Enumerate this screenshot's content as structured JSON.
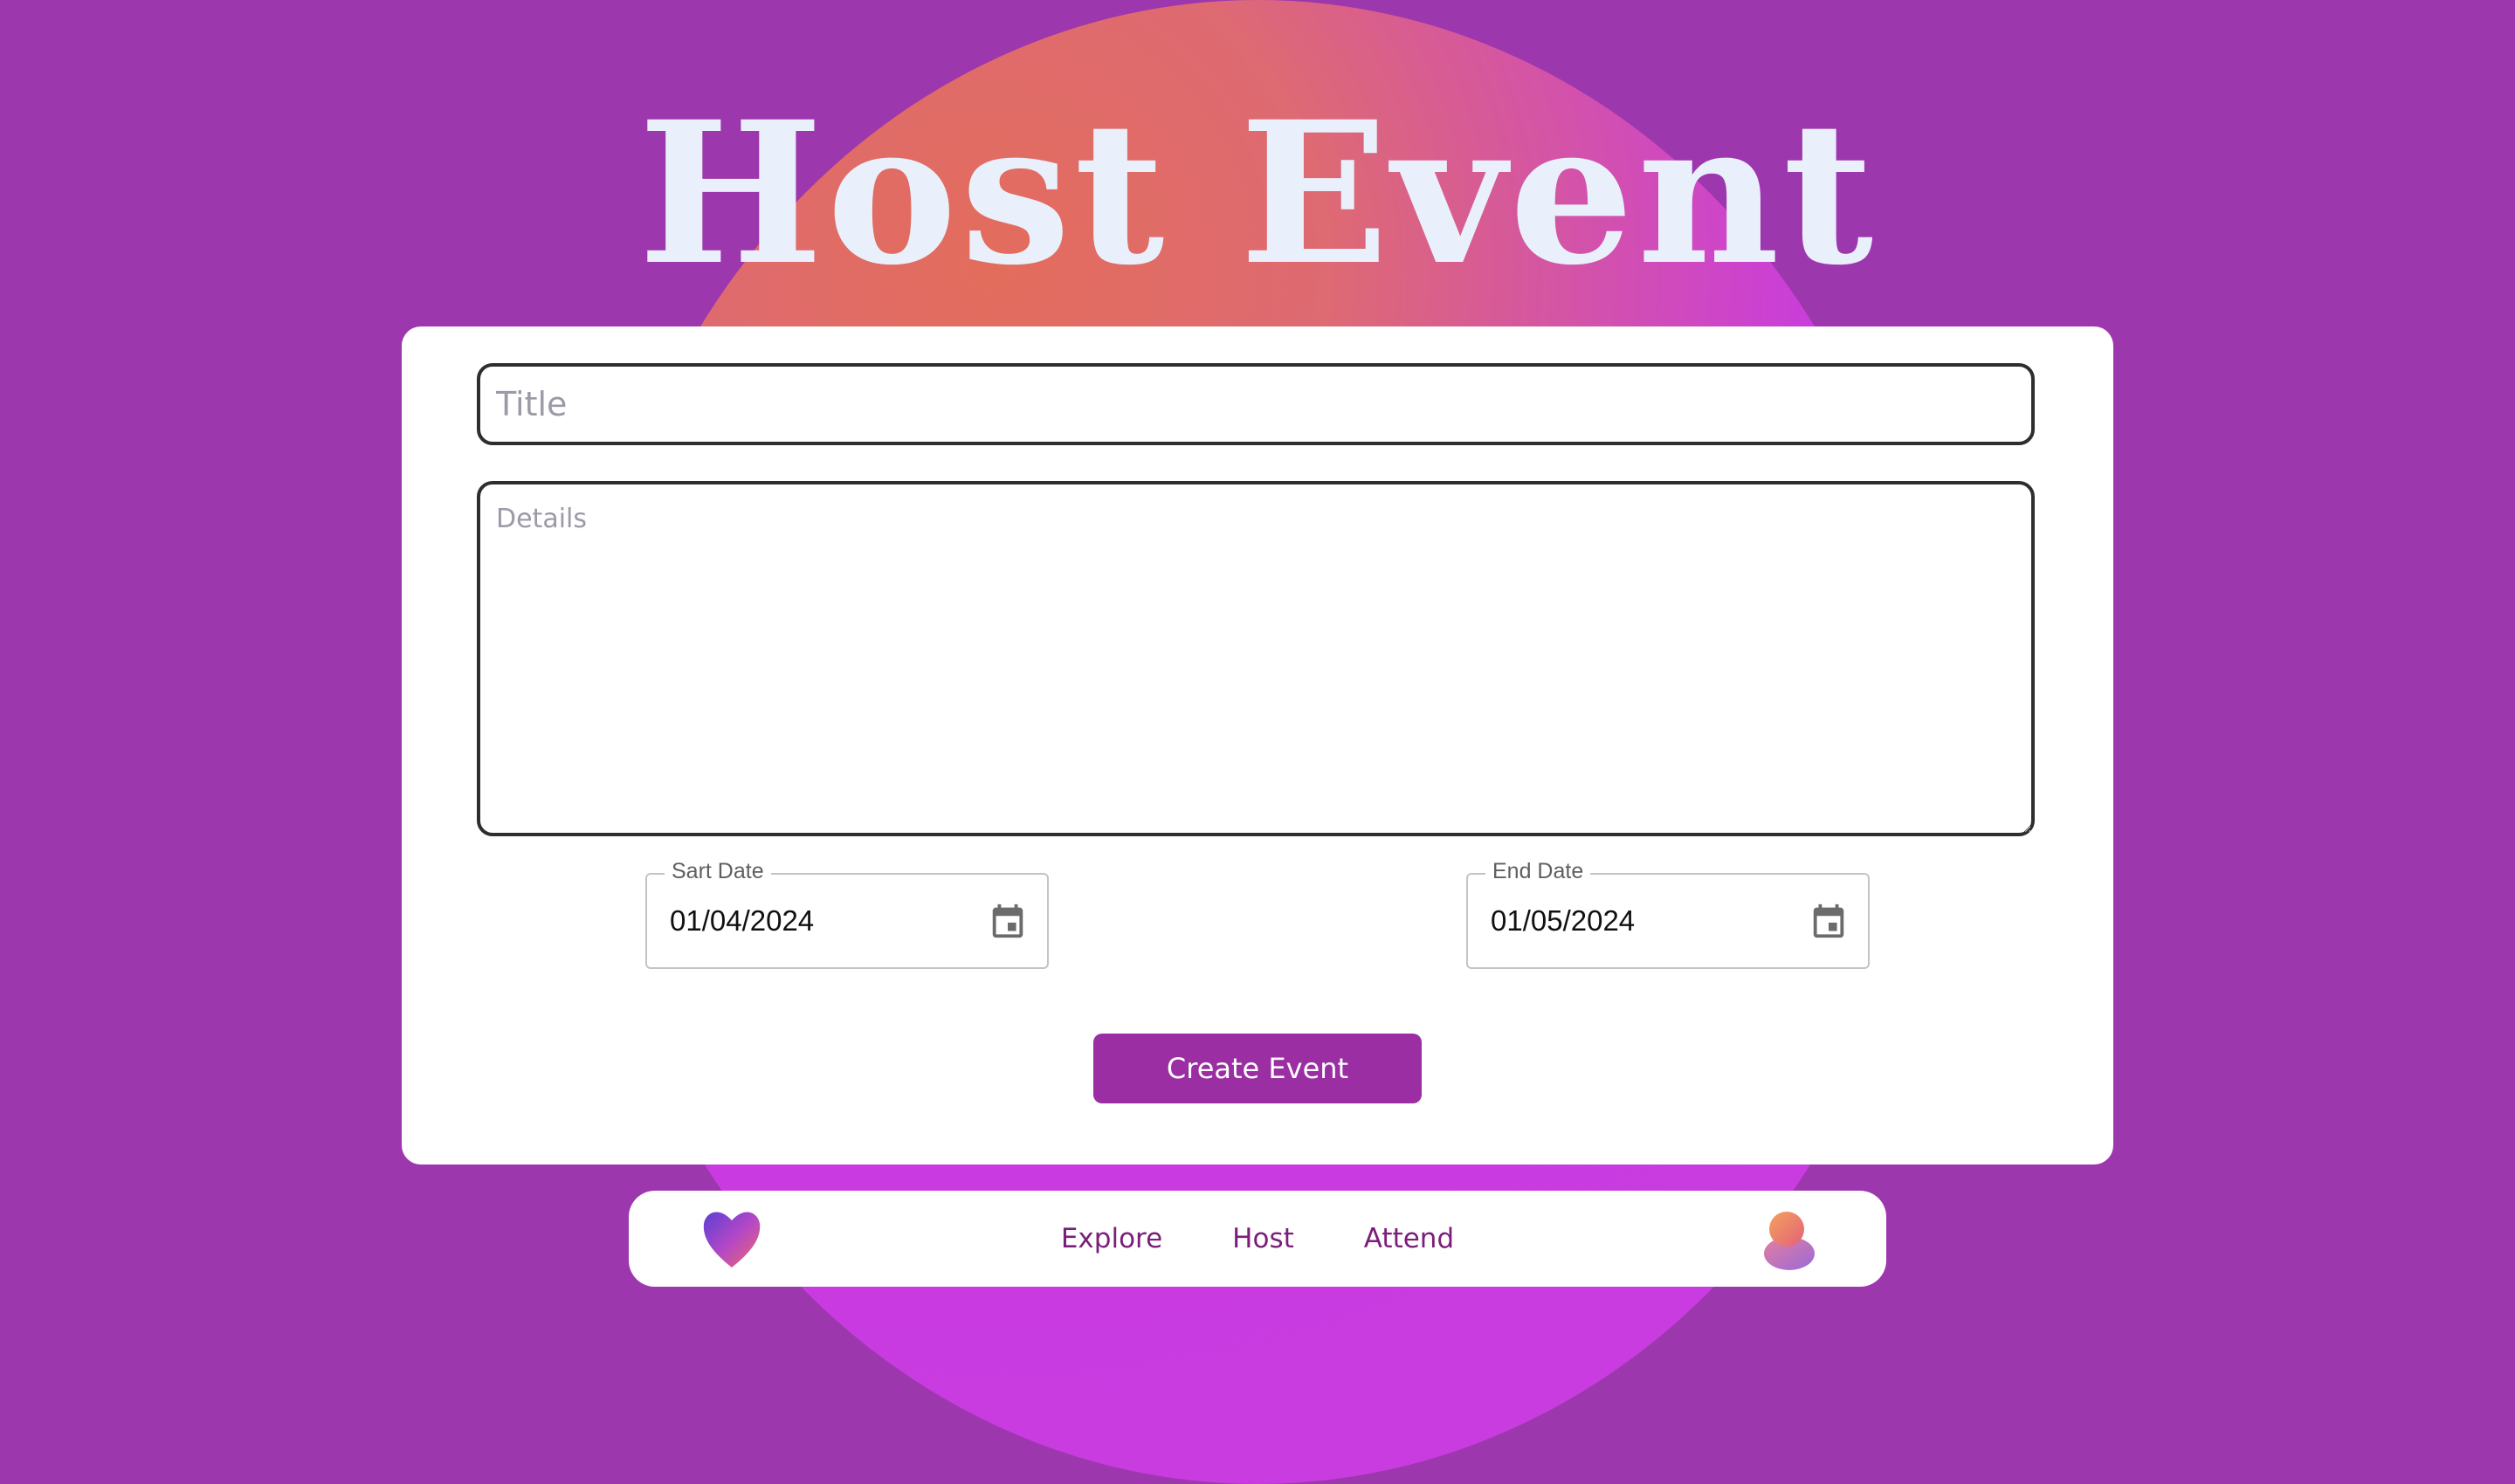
{
  "header": {
    "title": "Host Event"
  },
  "form": {
    "title_placeholder": "Title",
    "title_value": "",
    "details_placeholder": "Details",
    "details_value": "",
    "start_date": {
      "label": "Sart Date",
      "value": "01/04/2024",
      "icon": "calendar-icon"
    },
    "end_date": {
      "label": "End Date",
      "value": "01/05/2024",
      "icon": "calendar-icon"
    },
    "submit_label": "Create Event"
  },
  "nav": {
    "logo_icon": "heart-logo-icon",
    "links": [
      "Explore",
      "Host",
      "Attend"
    ],
    "avatar_icon": "avatar-icon"
  },
  "colors": {
    "background": "#9d37ad",
    "accent": "#9a2ea2",
    "nav_text": "#7b1e7a",
    "title_text": "#e9f0fb"
  }
}
